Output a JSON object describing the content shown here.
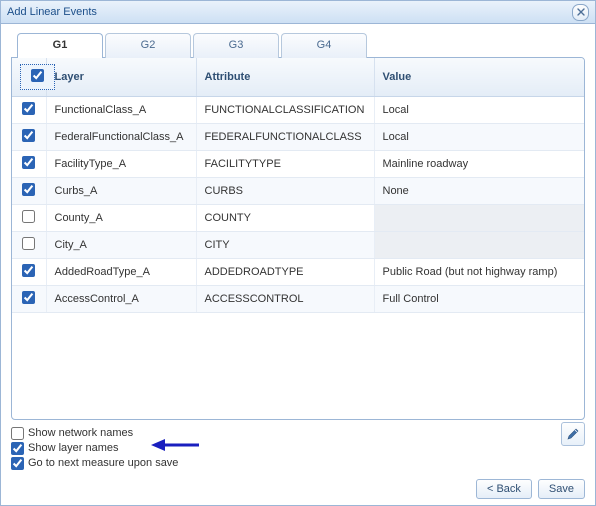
{
  "window": {
    "title": "Add Linear Events"
  },
  "tabs": [
    {
      "label": "G1",
      "active": true
    },
    {
      "label": "G2",
      "active": false
    },
    {
      "label": "G3",
      "active": false
    },
    {
      "label": "G4",
      "active": false
    }
  ],
  "grid": {
    "columns": {
      "layer": "Layer",
      "attribute": "Attribute",
      "value": "Value"
    },
    "headerChecked": true,
    "rows": [
      {
        "checked": true,
        "layer": "FunctionalClass_A",
        "attribute": "FUNCTIONALCLASSIFICATION",
        "value": "Local",
        "valueDisabled": false
      },
      {
        "checked": true,
        "layer": "FederalFunctionalClass_A",
        "attribute": "FEDERALFUNCTIONALCLASS",
        "value": "Local",
        "valueDisabled": false
      },
      {
        "checked": true,
        "layer": "FacilityType_A",
        "attribute": "FACILITYTYPE",
        "value": "Mainline roadway",
        "valueDisabled": false
      },
      {
        "checked": true,
        "layer": "Curbs_A",
        "attribute": "CURBS",
        "value": "None",
        "valueDisabled": false
      },
      {
        "checked": false,
        "layer": "County_A",
        "attribute": "COUNTY",
        "value": "",
        "valueDisabled": true
      },
      {
        "checked": false,
        "layer": "City_A",
        "attribute": "CITY",
        "value": "",
        "valueDisabled": true
      },
      {
        "checked": true,
        "layer": "AddedRoadType_A",
        "attribute": "ADDEDROADTYPE",
        "value": "Public Road (but not highway ramp)",
        "valueDisabled": false
      },
      {
        "checked": true,
        "layer": "AccessControl_A",
        "attribute": "ACCESSCONTROL",
        "value": "Full Control",
        "valueDisabled": false
      }
    ]
  },
  "options": {
    "show_network_names": {
      "label": "Show network names",
      "checked": false
    },
    "show_layer_names": {
      "label": "Show layer names",
      "checked": true
    },
    "go_to_next_measure": {
      "label": "Go to next measure upon save",
      "checked": true
    }
  },
  "buttons": {
    "back": "< Back",
    "save": "Save"
  }
}
